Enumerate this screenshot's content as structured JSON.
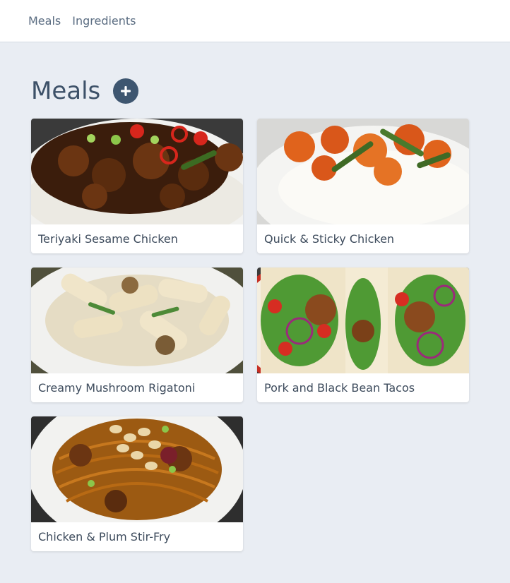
{
  "nav": {
    "items": [
      {
        "label": "Meals"
      },
      {
        "label": "Ingredients"
      }
    ]
  },
  "page": {
    "title": "Meals",
    "add_icon": "plus-circle-icon"
  },
  "meals": [
    {
      "title": "Teriyaki Sesame Chicken",
      "image": "teriyaki-sesame-chicken-photo"
    },
    {
      "title": "Quick & Sticky Chicken",
      "image": "quick-sticky-chicken-photo"
    },
    {
      "title": "Creamy Mushroom Rigatoni",
      "image": "creamy-mushroom-rigatoni-photo"
    },
    {
      "title": "Pork and Black Bean Tacos",
      "image": "pork-black-bean-tacos-photo"
    },
    {
      "title": "Chicken & Plum Stir-Fry",
      "image": "chicken-plum-stir-fry-photo"
    }
  ],
  "colors": {
    "background": "#e9edf3",
    "accent": "#3e5670",
    "nav_text": "#5b6d82"
  }
}
